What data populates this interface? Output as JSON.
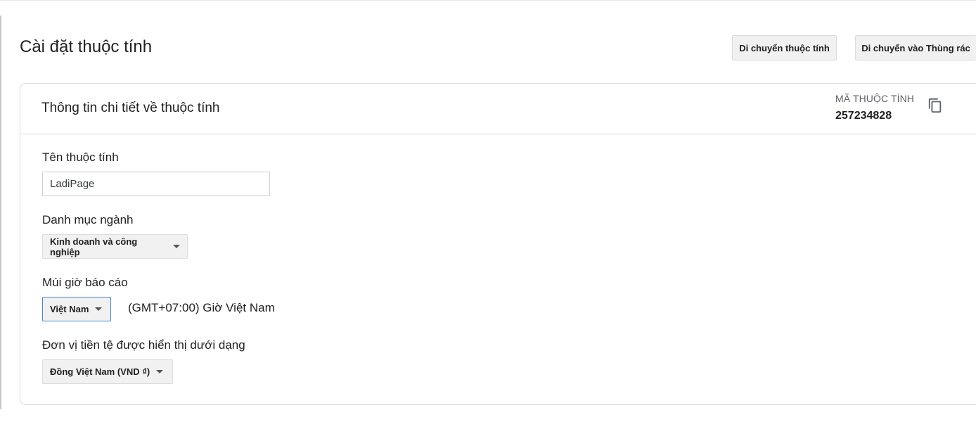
{
  "page": {
    "title": "Cài đặt thuộc tính",
    "buttons": {
      "move": "Di chuyển thuộc tính",
      "trash": "Di chuyển vào Thùng rác"
    }
  },
  "card": {
    "title": "Thông tin chi tiết về thuộc tính",
    "property_id_label": "MÃ THUỘC TÍNH",
    "property_id_value": "257234828",
    "copy_icon": "copy-icon"
  },
  "fields": {
    "name": {
      "label": "Tên thuộc tính",
      "value": "LadiPage"
    },
    "industry": {
      "label": "Danh mục ngành",
      "selected": "Kinh doanh và công nghiệp"
    },
    "timezone": {
      "label": "Múi giờ báo cáo",
      "country": "Việt Nam",
      "zone": "(GMT+07:00) Giờ Việt Nam"
    },
    "currency": {
      "label": "Đơn vị tiền tệ được hiển thị dưới dạng",
      "selected": "Đồng Việt Nam (VND ₫)"
    }
  },
  "colors": {
    "button_bg": "#f1f1f1",
    "border": "#dadce0",
    "focus_border": "#4a86c7",
    "text": "#212121",
    "muted": "#5f6368"
  }
}
